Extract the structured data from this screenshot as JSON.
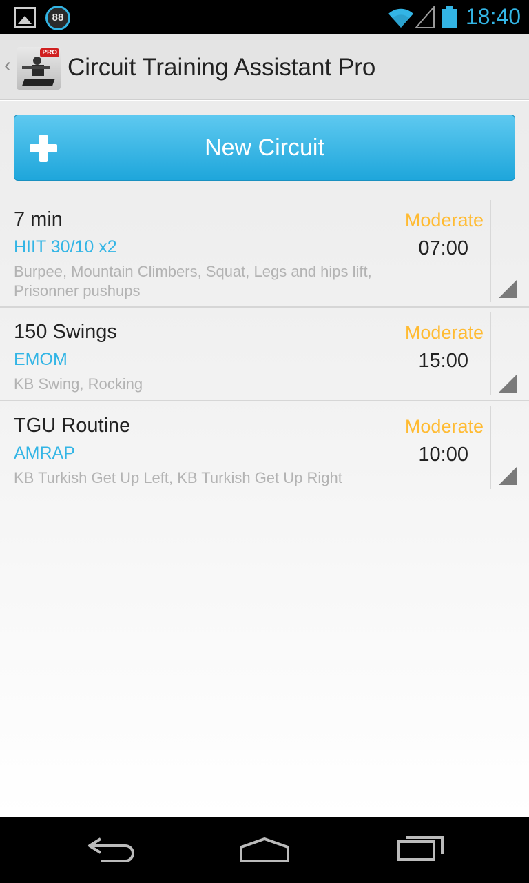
{
  "status_bar": {
    "notification_count": "88",
    "time": "18:40",
    "accent_color": "#33b5e5",
    "icons": [
      "gallery-icon",
      "wifi-icon",
      "signal-icon",
      "battery-icon"
    ]
  },
  "action_bar": {
    "title": "Circuit Training Assistant Pro",
    "icon_badge": "PRO"
  },
  "new_circuit_button": {
    "label": "New Circuit"
  },
  "circuits": [
    {
      "name": "7 min",
      "type": "HIIT 30/10 x2",
      "exercises": "Burpee, Mountain Climbers, Squat, Legs and hips lift, Prisonner pushups",
      "level": "Moderate",
      "duration": "07:00"
    },
    {
      "name": "150 Swings",
      "type": "EMOM",
      "exercises": "KB Swing, Rocking",
      "level": "Moderate",
      "duration": "15:00"
    },
    {
      "name": "TGU Routine",
      "type": "AMRAP",
      "exercises": "KB Turkish Get Up Left, KB Turkish Get Up Right",
      "level": "Moderate",
      "duration": "10:00"
    }
  ],
  "colors": {
    "type_text": "#33b5e5",
    "level_text": "#ffbb33",
    "button_top": "#5ec9f0",
    "button_bottom": "#1ea6db"
  }
}
